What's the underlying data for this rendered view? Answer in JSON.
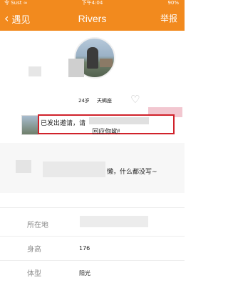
{
  "status_bar": {
    "carrier": "令 Sust ≈",
    "time": "下午4:04",
    "battery": "90%"
  },
  "nav": {
    "back_label": "遇见",
    "title": "Rivers",
    "report_label": "举报"
  },
  "profile": {
    "age": "24岁",
    "zodiac": "天蝎座"
  },
  "invite": {
    "line1": "已发出邀请，请",
    "line2": "回应你呦!"
  },
  "signature": {
    "text": "懒，什么都没写~"
  },
  "details": [
    {
      "label": "所在地",
      "value": ""
    },
    {
      "label": "身高",
      "value": "176"
    },
    {
      "label": "体型",
      "value": "阳光"
    }
  ],
  "colors": {
    "accent": "#f28a1e",
    "highlight_border": "#d0222b"
  },
  "icons": {
    "back": "chevron-left-icon",
    "like": "heart-outline-icon"
  }
}
